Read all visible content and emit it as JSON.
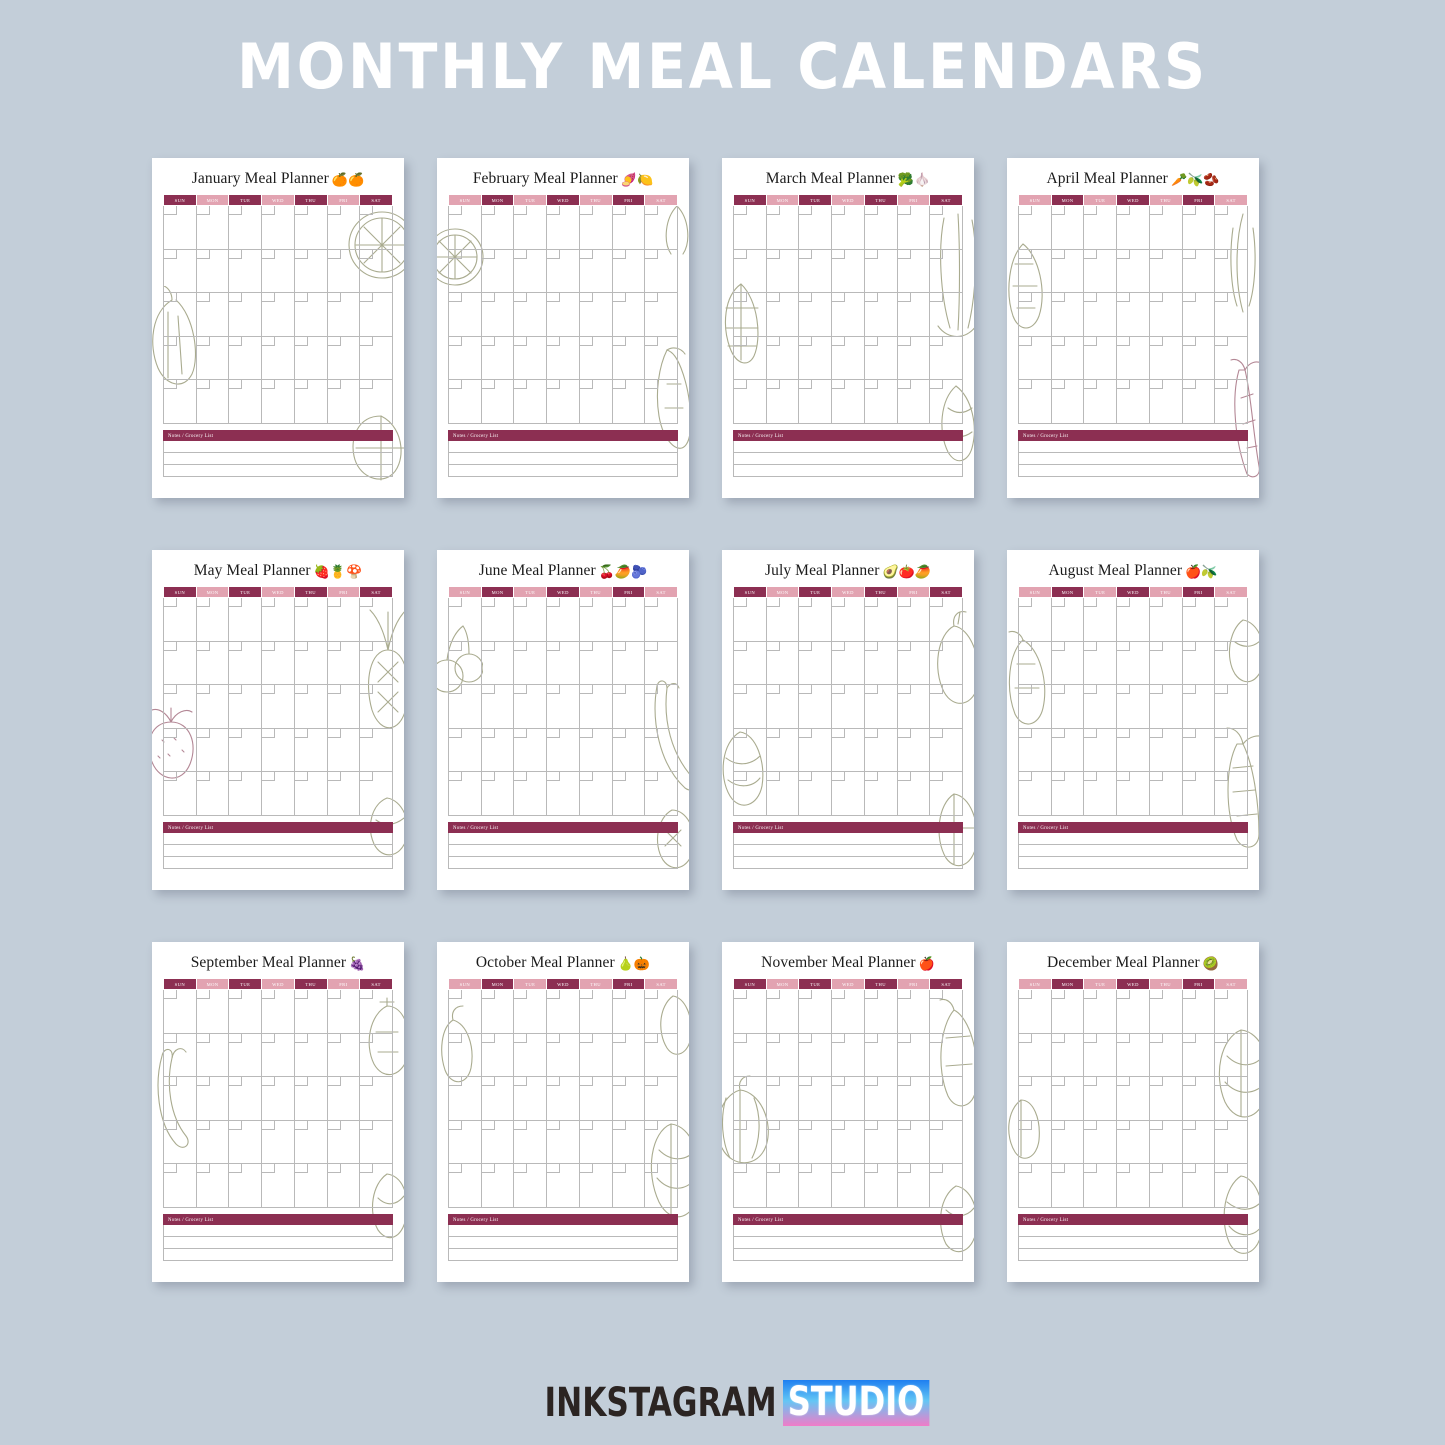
{
  "page": {
    "title": "MONTHLY MEAL CALENDARS",
    "background_color": "#c3ced9",
    "title_color": "#ffffff"
  },
  "theme": {
    "header_dark": "#8c2f52",
    "header_light": "#e2a3b1",
    "grid_line": "#b9b9b9",
    "card_background": "#ffffff"
  },
  "weekdays": [
    "SUN",
    "MON",
    "TUE",
    "WED",
    "THU",
    "FRI",
    "SAT"
  ],
  "notes_label": "Notes / Grocery List",
  "calendars": [
    {
      "title": "January Meal Planner",
      "emojis": "🍊🍊",
      "header_start": "dark",
      "deco": "grapefruit-and-squash-line-art"
    },
    {
      "title": "February Meal Planner",
      "emojis": "🍠🍋",
      "header_start": "light",
      "deco": "citrus-and-leek-line-art"
    },
    {
      "title": "March Meal Planner",
      "emojis": "🥦🧄",
      "header_start": "dark",
      "deco": "artichoke-and-celery-line-art"
    },
    {
      "title": "April Meal Planner",
      "emojis": "🥕🫒🫘",
      "header_start": "light",
      "deco": "carrot-and-asparagus-line-art"
    },
    {
      "title": "May Meal Planner",
      "emojis": "🍓🍍🍄",
      "header_start": "dark",
      "deco": "strawberry-and-pineapple-line-art"
    },
    {
      "title": "June Meal Planner",
      "emojis": "🍒🥭🫐",
      "header_start": "light",
      "deco": "banana-and-cherry-line-art"
    },
    {
      "title": "July Meal Planner",
      "emojis": "🥑🍅🥭",
      "header_start": "dark",
      "deco": "pepper-and-melon-line-art"
    },
    {
      "title": "August Meal Planner",
      "emojis": "🍎🫒",
      "header_start": "light",
      "deco": "corn-and-eggplant-line-art"
    },
    {
      "title": "September Meal Planner",
      "emojis": "🍇",
      "header_start": "dark",
      "deco": "chili-and-fig-line-art"
    },
    {
      "title": "October Meal Planner",
      "emojis": "🍐🎃",
      "header_start": "light",
      "deco": "pear-and-cabbage-line-art"
    },
    {
      "title": "November Meal Planner",
      "emojis": "🍎",
      "header_start": "dark",
      "deco": "pumpkin-and-squash-line-art"
    },
    {
      "title": "December Meal Planner",
      "emojis": "🥝",
      "header_start": "light",
      "deco": "cabbage-and-root-line-art"
    }
  ],
  "footer": {
    "brand_primary": "INKSTAGRAM",
    "brand_secondary": "STUDIO",
    "brand_secondary_gradient": [
      "#1f7ff0",
      "#63c6f5",
      "#f07cc8"
    ]
  }
}
